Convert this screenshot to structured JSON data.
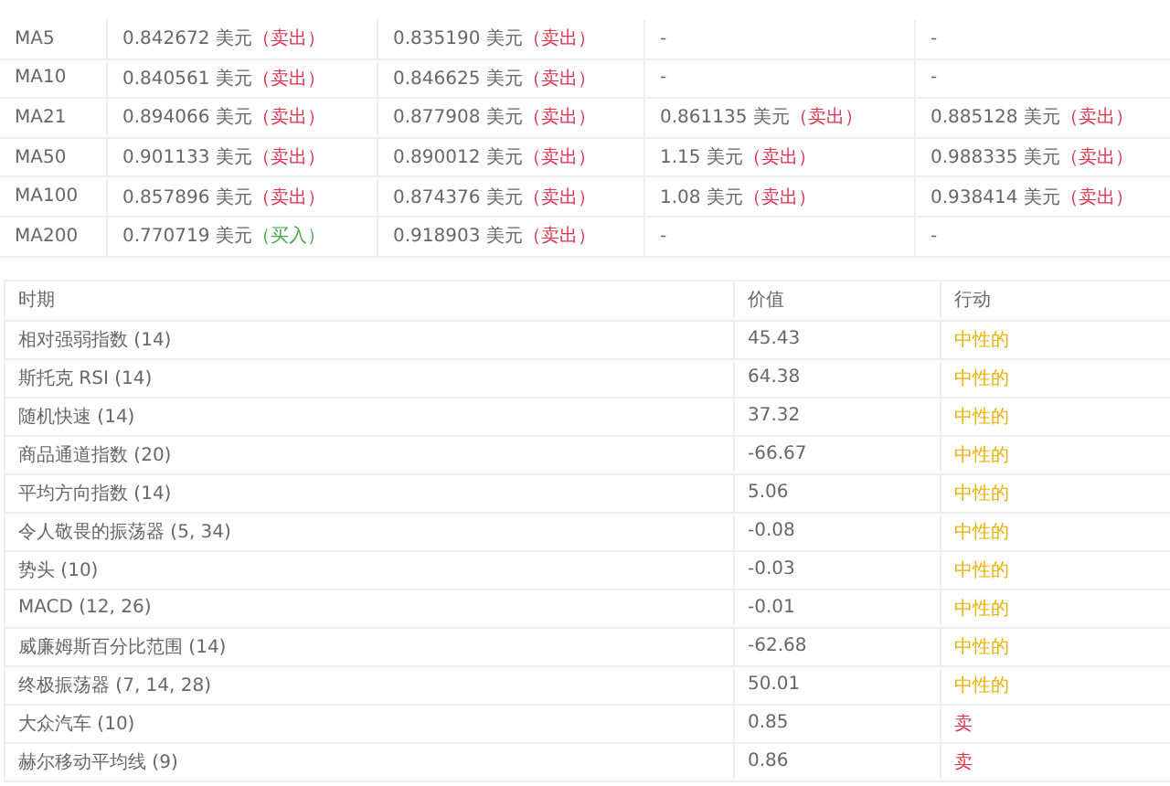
{
  "moving_averages": {
    "rows": [
      {
        "name": "MA5",
        "cells": [
          {
            "price": "0.842672 美元",
            "signal": "（卖出）",
            "kind": "sell"
          },
          {
            "price": "0.835190 美元",
            "signal": "（卖出）",
            "kind": "sell"
          },
          {
            "price": "-",
            "kind": "empty"
          },
          {
            "price": "-",
            "kind": "empty"
          }
        ]
      },
      {
        "name": "MA10",
        "cells": [
          {
            "price": "0.840561 美元",
            "signal": "（卖出）",
            "kind": "sell"
          },
          {
            "price": "0.846625 美元",
            "signal": "（卖出）",
            "kind": "sell"
          },
          {
            "price": "-",
            "kind": "empty"
          },
          {
            "price": "-",
            "kind": "empty"
          }
        ]
      },
      {
        "name": "MA21",
        "cells": [
          {
            "price": "0.894066 美元",
            "signal": "（卖出）",
            "kind": "sell"
          },
          {
            "price": "0.877908 美元",
            "signal": "（卖出）",
            "kind": "sell"
          },
          {
            "price": "0.861135 美元",
            "signal": "（卖出）",
            "kind": "sell"
          },
          {
            "price": "0.885128 美元",
            "signal": "（卖出）",
            "kind": "sell"
          }
        ]
      },
      {
        "name": "MA50",
        "cells": [
          {
            "price": "0.901133 美元",
            "signal": "（卖出）",
            "kind": "sell"
          },
          {
            "price": "0.890012 美元",
            "signal": "（卖出）",
            "kind": "sell"
          },
          {
            "price": "1.15 美元",
            "signal": "（卖出）",
            "kind": "sell"
          },
          {
            "price": "0.988335 美元",
            "signal": "（卖出）",
            "kind": "sell"
          }
        ]
      },
      {
        "name": "MA100",
        "cells": [
          {
            "price": "0.857896 美元",
            "signal": "（卖出）",
            "kind": "sell"
          },
          {
            "price": "0.874376 美元",
            "signal": "（卖出）",
            "kind": "sell"
          },
          {
            "price": "1.08 美元",
            "signal": "（卖出）",
            "kind": "sell"
          },
          {
            "price": "0.938414 美元",
            "signal": "（卖出）",
            "kind": "sell"
          }
        ]
      },
      {
        "name": "MA200",
        "cells": [
          {
            "price": "0.770719 美元",
            "signal": "（买入）",
            "kind": "buy"
          },
          {
            "price": "0.918903 美元",
            "signal": "（卖出）",
            "kind": "sell"
          },
          {
            "price": "-",
            "kind": "empty"
          },
          {
            "price": "-",
            "kind": "empty"
          }
        ]
      }
    ]
  },
  "oscillators": {
    "columns": [
      "时期",
      "价值",
      "行动"
    ],
    "rows": [
      {
        "name": "相对强弱指数 (14)",
        "value": "45.43",
        "action": "中性的",
        "kind": "neutral"
      },
      {
        "name": "斯托克 RSI (14)",
        "value": "64.38",
        "action": "中性的",
        "kind": "neutral"
      },
      {
        "name": "随机快速 (14)",
        "value": "37.32",
        "action": "中性的",
        "kind": "neutral"
      },
      {
        "name": "商品通道指数 (20)",
        "value": "-66.67",
        "action": "中性的",
        "kind": "neutral"
      },
      {
        "name": "平均方向指数 (14)",
        "value": "5.06",
        "action": "中性的",
        "kind": "neutral"
      },
      {
        "name": "令人敬畏的振荡器 (5, 34)",
        "value": "-0.08",
        "action": "中性的",
        "kind": "neutral"
      },
      {
        "name": "势头 (10)",
        "value": "-0.03",
        "action": "中性的",
        "kind": "neutral"
      },
      {
        "name": "MACD (12, 26)",
        "value": "-0.01",
        "action": "中性的",
        "kind": "neutral"
      },
      {
        "name": "威廉姆斯百分比范围 (14)",
        "value": "-62.68",
        "action": "中性的",
        "kind": "neutral"
      },
      {
        "name": "终极振荡器 (7, 14, 28)",
        "value": "50.01",
        "action": "中性的",
        "kind": "neutral"
      },
      {
        "name": "大众汽车 (10)",
        "value": "0.85",
        "action": "卖",
        "kind": "sell"
      },
      {
        "name": "赫尔移动平均线 (9)",
        "value": "0.86",
        "action": "卖",
        "kind": "sell"
      }
    ]
  }
}
